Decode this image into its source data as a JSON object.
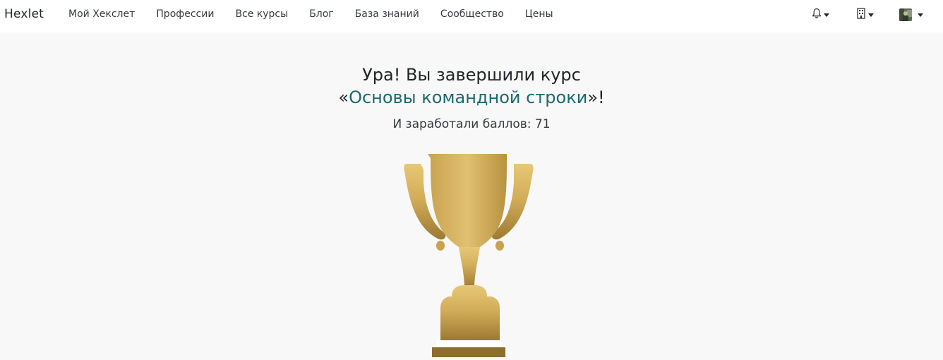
{
  "nav": {
    "brand": "Hexlet",
    "links": [
      "Мой Хекслет",
      "Профессии",
      "Все курсы",
      "Блог",
      "База знаний",
      "Сообщество",
      "Цены"
    ],
    "right_icons": [
      "bell-icon",
      "building-icon",
      "avatar"
    ]
  },
  "hero": {
    "title_line1": "Ура! Вы завершили курс",
    "quote_open": "«",
    "course_name": "Основы командной строки",
    "quote_close": "»!",
    "score_text": "И заработали баллов: 71"
  },
  "colors": {
    "link": "#1a6a6f",
    "trophy_gold": "#d9b45e",
    "background": "#f8f8f8"
  }
}
